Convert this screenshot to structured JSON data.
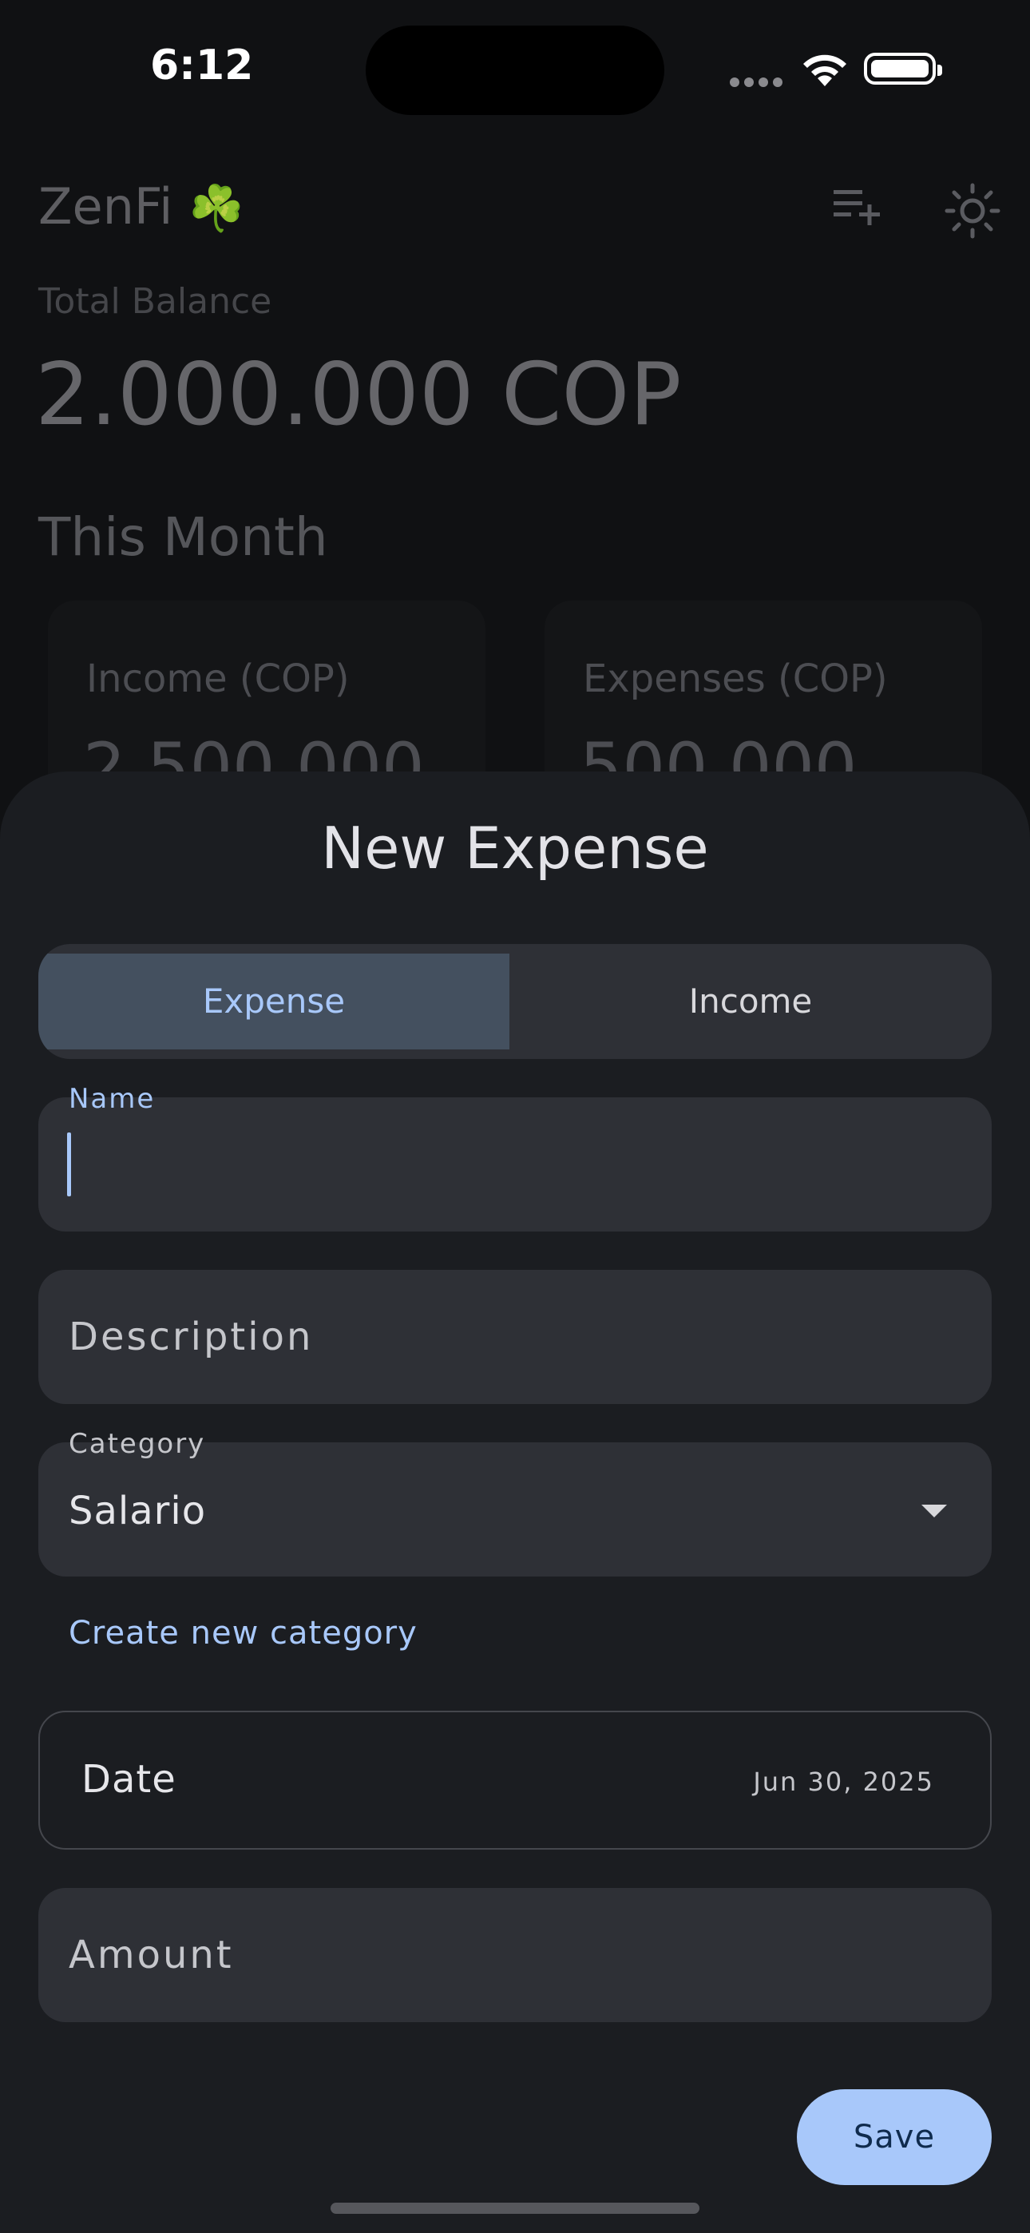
{
  "status_bar": {
    "time": "6:12"
  },
  "background_screen": {
    "app_title": "ZenFi",
    "app_emoji": "☘️",
    "header_icons": [
      "playlist-add-icon",
      "sun-icon"
    ],
    "total_balance_label": "Total Balance",
    "total_balance_value": "2.000.000 COP",
    "section_title": "This Month",
    "income_card": {
      "label": "Income (COP)",
      "value": "2.500.000"
    },
    "expenses_card": {
      "label": "Expenses (COP)",
      "value": "500.000"
    }
  },
  "sheet": {
    "title": "New Expense",
    "segments": {
      "expense": "Expense",
      "income": "Income",
      "selected": "Expense"
    },
    "name_field": {
      "label": "Name",
      "value": ""
    },
    "description_field": {
      "placeholder": "Description"
    },
    "category_field": {
      "label": "Category",
      "value": "Salario"
    },
    "create_category_link": "Create new category",
    "date_field": {
      "label": "Date",
      "value": "Jun 30, 2025"
    },
    "amount_field": {
      "placeholder": "Amount"
    },
    "save_button": "Save"
  },
  "colors": {
    "accent": "#a8c8fa",
    "sheet_bg": "#1b1d21",
    "field_bg": "#2e3036",
    "selected_segment_bg": "#44505f"
  }
}
